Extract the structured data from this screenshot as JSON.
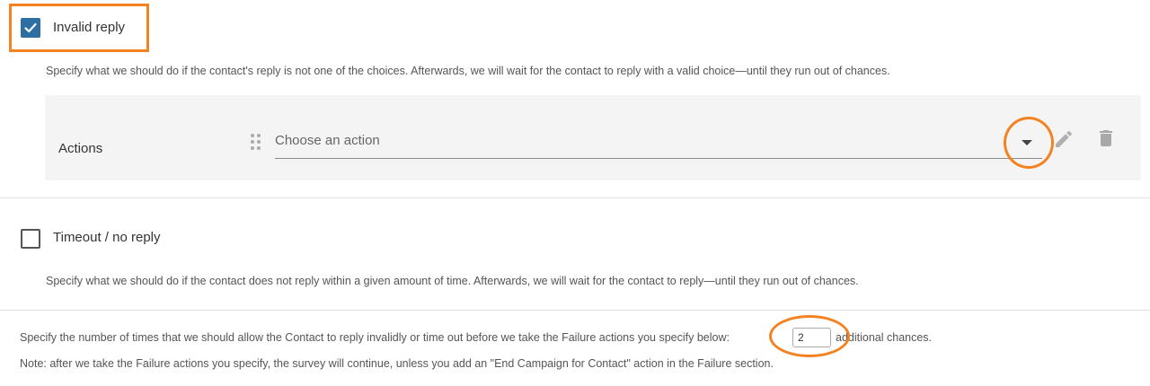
{
  "invalid_reply": {
    "label": "Invalid reply",
    "checked": true,
    "description": "Specify what we should do if the contact's reply is not one of the choices. Afterwards, we will wait for the contact to reply with a valid choice—until they run out of chances."
  },
  "actions": {
    "label": "Actions",
    "select_placeholder": "Choose an action",
    "icons": [
      "drag-handle-icon",
      "chevron-down-icon",
      "pencil-icon",
      "trash-icon"
    ]
  },
  "timeout": {
    "label": "Timeout / no reply",
    "checked": false,
    "description": "Specify what we should do if the contact does not reply within a given amount of time. Afterwards, we will wait for the contact to reply—until they run out of chances."
  },
  "chances": {
    "prefix": "Specify the number of times that we should allow the Contact to reply invalidly or time out before we take the Failure actions you specify below:",
    "value": "2",
    "suffix": "additional chances.",
    "note": "Note: after we take the Failure actions you specify, the survey will continue, unless you add an \"End Campaign for Contact\" action in the Failure section."
  },
  "colors": {
    "checkbox_checked": "#2d6fa3",
    "annotation": "#f58220",
    "panel_background": "#f4f4f4"
  }
}
